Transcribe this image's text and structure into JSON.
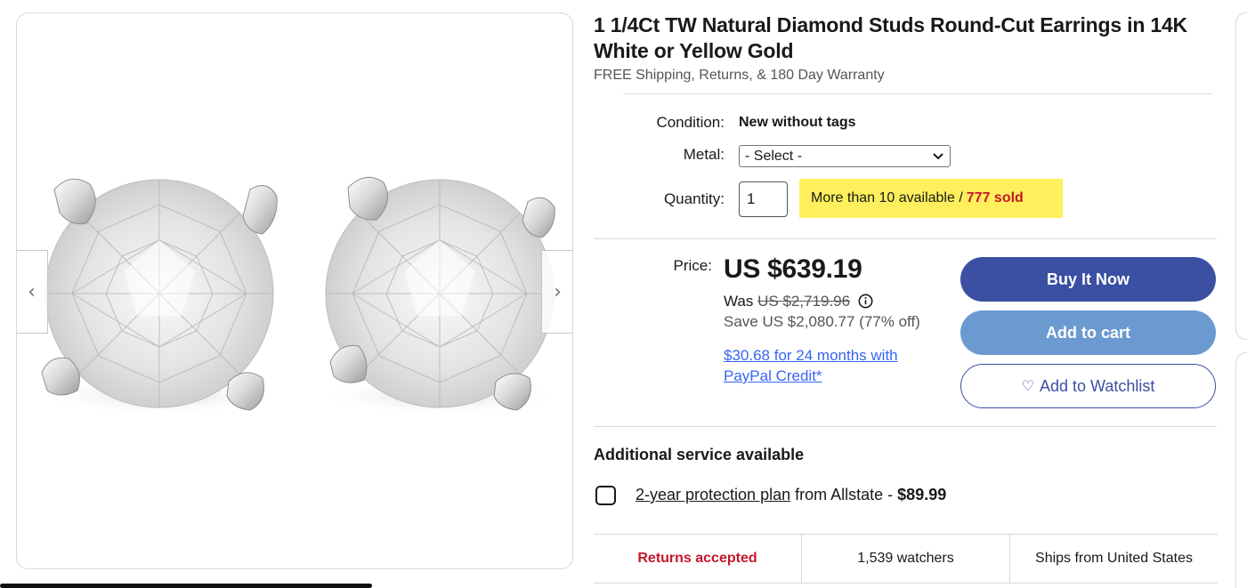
{
  "product": {
    "title": "1 1/4Ct TW Natural Diamond Studs Round-Cut Earrings in 14K White or Yellow Gold",
    "subtitle": "FREE Shipping, Returns, & 180 Day Warranty"
  },
  "gallery": {
    "prev_arrow": "‹",
    "next_arrow": "›"
  },
  "options": {
    "condition_label": "Condition:",
    "condition_value": "New without tags",
    "metal_label": "Metal:",
    "metal_selected": "- Select -",
    "quantity_label": "Quantity:",
    "quantity_value": "1",
    "availability_text": "More than 10 available /",
    "sold_text": "777 sold"
  },
  "pricing": {
    "price_label": "Price:",
    "price": "US $639.19",
    "was_label": "Was",
    "was_price": "US $2,719.96",
    "save_text": "Save US $2,080.77 (77% off)",
    "paypal_text": "$30.68 for 24 months with PayPal Credit*"
  },
  "actions": {
    "buy_now": "Buy It Now",
    "add_to_cart": "Add to cart",
    "watchlist": "Add to Watchlist"
  },
  "service": {
    "title": "Additional service available",
    "plan_link": "2-year protection plan",
    "plan_from": "from Allstate -",
    "plan_price": "$89.99"
  },
  "stats": {
    "returns": "Returns accepted",
    "watchers": "1,539 watchers",
    "ships": "Ships from United States"
  },
  "colors": {
    "buy_button": "#3b4fa3",
    "cart_button": "#6b9ad0",
    "availability_highlight": "#ffef5c",
    "sold_red": "#c4162a",
    "link_blue": "#3665f3"
  }
}
